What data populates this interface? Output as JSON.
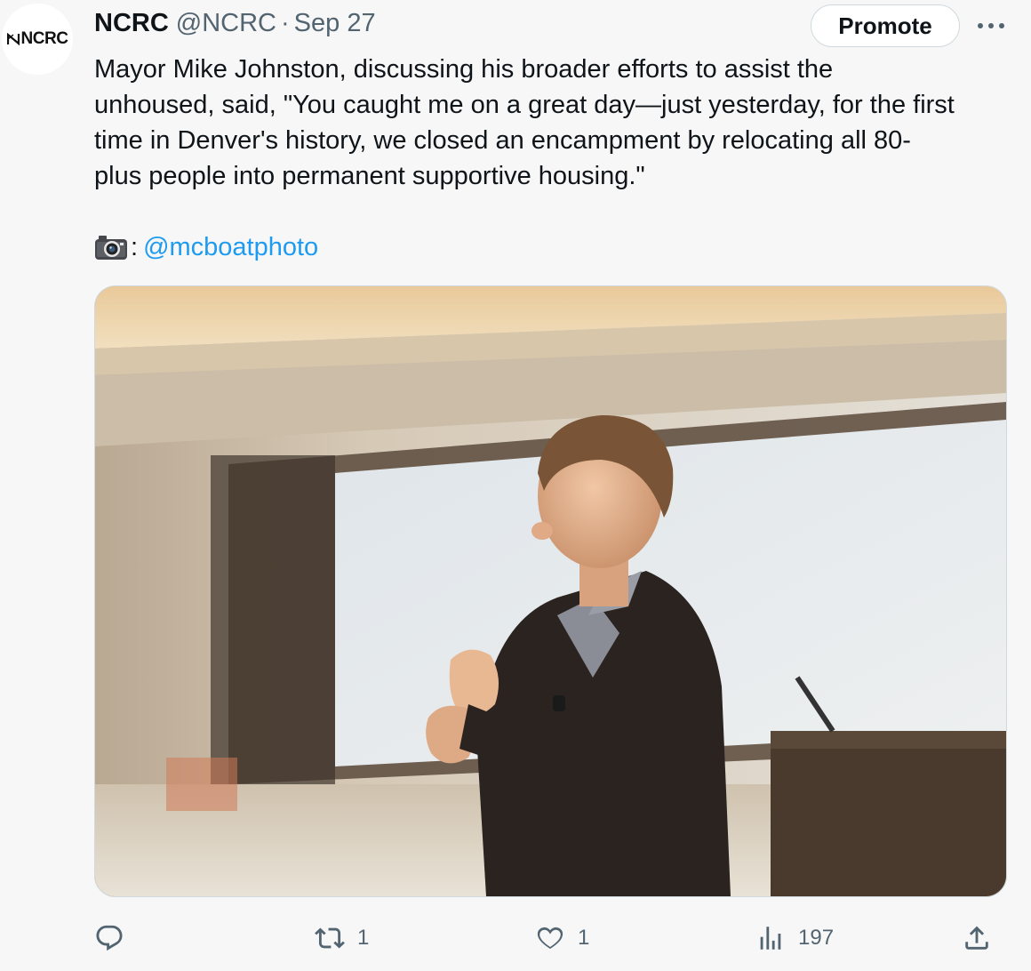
{
  "author": {
    "name": "NCRC",
    "handle": "@NCRC",
    "separator": "·",
    "date": "Sep 27",
    "avatar_text": "NCRC"
  },
  "buttons": {
    "promote_label": "Promote",
    "more_icon": "more-horizontal-icon"
  },
  "tweet": {
    "text": "Mayor Mike Johnston, discussing his broader efforts to assist the\nunhoused, said, \"You caught me on a great day—just yesterday, for the first\ntime in Denver's history, we closed an encampment by relocating all 80-\nplus people into permanent supportive housing.\"",
    "credit_icon": "camera-emoji-icon",
    "credit_colon": ":",
    "credit_link": "@mcboatphoto"
  },
  "actions": {
    "reply": {
      "icon": "reply-icon",
      "count": ""
    },
    "retweet": {
      "icon": "retweet-icon",
      "count": "1"
    },
    "like": {
      "icon": "heart-icon",
      "count": "1"
    },
    "views": {
      "icon": "views-chart-icon",
      "count": "197"
    },
    "share": {
      "icon": "share-icon",
      "count": ""
    }
  },
  "colors": {
    "background": "#f7f7f7",
    "text": "#0f1419",
    "secondary_text": "#536471",
    "link": "#1d9bf0",
    "border": "#cfd9de"
  }
}
